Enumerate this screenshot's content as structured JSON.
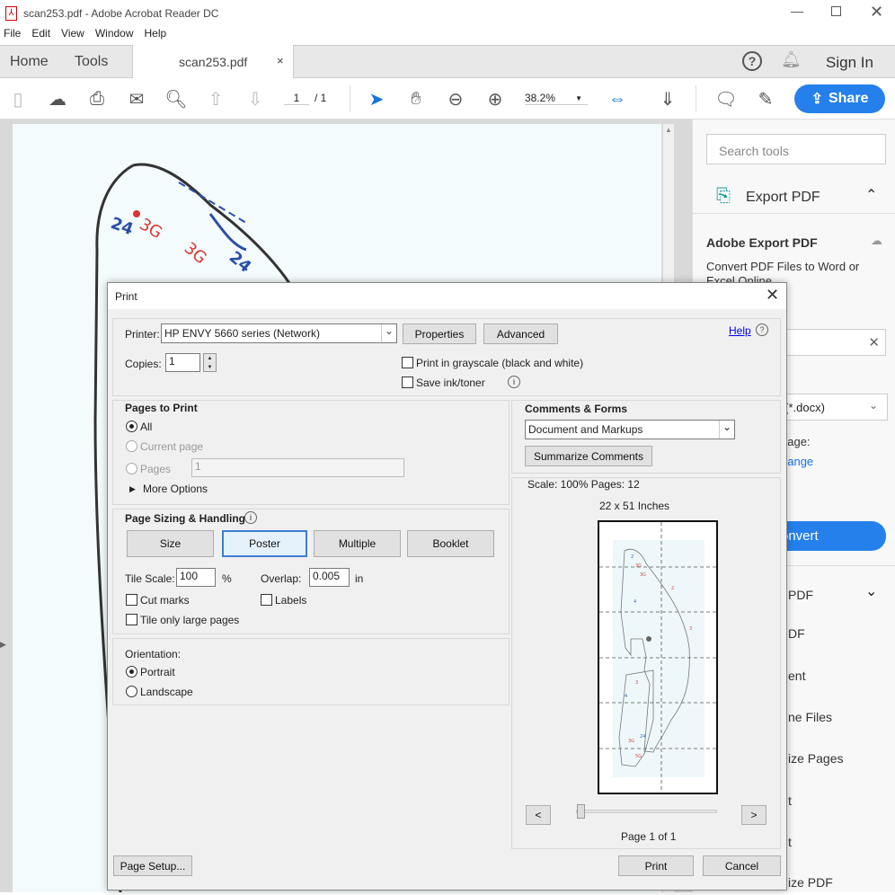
{
  "window": {
    "title": "scan253.pdf - Adobe Acrobat Reader DC"
  },
  "menu": [
    "File",
    "Edit",
    "View",
    "Window",
    "Help"
  ],
  "tabs": {
    "home": "Home",
    "tools": "Tools",
    "doc": "scan253.pdf",
    "sign_in": "Sign In"
  },
  "toolbar": {
    "page_current": "1",
    "page_total": "/ 1",
    "zoom": "38.2%",
    "share": "Share"
  },
  "sidebar": {
    "search_placeholder": "Search tools",
    "export_pdf": "Export PDF",
    "adobe_export": "Adobe Export PDF",
    "convert_desc": "Convert PDF Files to Word or",
    "convert_desc2": "Excel Online",
    "format_fragment": "rd (*.docx)",
    "language_fragment": "uage:",
    "change_fragment": "hange",
    "convert_fragment": "onvert",
    "items": [
      "PDF",
      "DF",
      "ent",
      "ne Files",
      "ize Pages",
      "t",
      "t",
      "ize PDF"
    ]
  },
  "dialog": {
    "title": "Print",
    "printer_label": "Printer:",
    "printer_value": "HP ENVY 5660 series (Network)",
    "properties": "Properties",
    "advanced": "Advanced",
    "help": "Help",
    "copies_label": "Copies:",
    "copies_value": "1",
    "grayscale": "Print in grayscale (black and white)",
    "save_ink": "Save ink/toner",
    "pages_heading": "Pages to Print",
    "all": "All",
    "current_page": "Current page",
    "pages": "Pages",
    "pages_value": "1",
    "more_options": "More Options",
    "sizing_heading": "Page Sizing & Handling",
    "size": "Size",
    "poster": "Poster",
    "multiple": "Multiple",
    "booklet": "Booklet",
    "tile_scale_label": "Tile Scale:",
    "tile_scale_value": "100",
    "percent": "%",
    "overlap_label": "Overlap:",
    "overlap_value": "0.005",
    "overlap_unit": "in",
    "cut_marks": "Cut marks",
    "labels": "Labels",
    "tile_large": "Tile only large pages",
    "orientation_heading": "Orientation:",
    "portrait": "Portrait",
    "landscape": "Landscape",
    "comments_heading": "Comments & Forms",
    "comments_value": "Document and Markups",
    "summarize": "Summarize Comments",
    "scale_info": "Scale: 100% Pages: 12",
    "paper_size": "22 x 51 Inches",
    "prev": "<",
    "next": ">",
    "page_info": "Page 1 of 1",
    "page_setup": "Page Setup...",
    "print": "Print",
    "cancel": "Cancel"
  },
  "colors": {
    "accent": "#1473e6",
    "share_bg": "#2680eb"
  }
}
